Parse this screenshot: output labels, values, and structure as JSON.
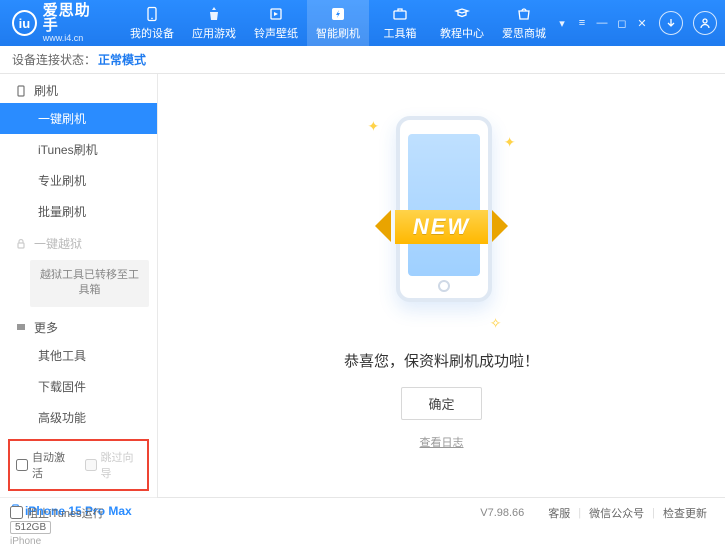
{
  "app": {
    "name": "爱思助手",
    "url": "www.i4.cn"
  },
  "nav": {
    "items": [
      {
        "label": "我的设备"
      },
      {
        "label": "应用游戏"
      },
      {
        "label": "铃声壁纸"
      },
      {
        "label": "智能刷机"
      },
      {
        "label": "工具箱"
      },
      {
        "label": "教程中心"
      },
      {
        "label": "爱思商城"
      }
    ]
  },
  "status": {
    "prefix": "设备连接状态：",
    "mode": "正常模式"
  },
  "sidebar": {
    "group_flash": "刷机",
    "items_flash": [
      "一键刷机",
      "iTunes刷机",
      "专业刷机",
      "批量刷机"
    ],
    "group_jailbreak": "一键越狱",
    "jailbreak_moved": "越狱工具已转移至工具箱",
    "group_more": "更多",
    "items_more": [
      "其他工具",
      "下载固件",
      "高级功能"
    ],
    "checks": {
      "auto_activate": "自动激活",
      "skip_guide": "跳过向导"
    },
    "device": {
      "name": "iPhone 15 Pro Max",
      "storage": "512GB",
      "type": "iPhone"
    }
  },
  "main": {
    "ribbon": "NEW",
    "success": "恭喜您，保资料刷机成功啦！",
    "ok": "确定",
    "view_log": "查看日志"
  },
  "footer": {
    "block_itunes": "阻止iTunes运行",
    "version": "V7.98.66",
    "links": [
      "客服",
      "微信公众号",
      "检查更新"
    ]
  }
}
